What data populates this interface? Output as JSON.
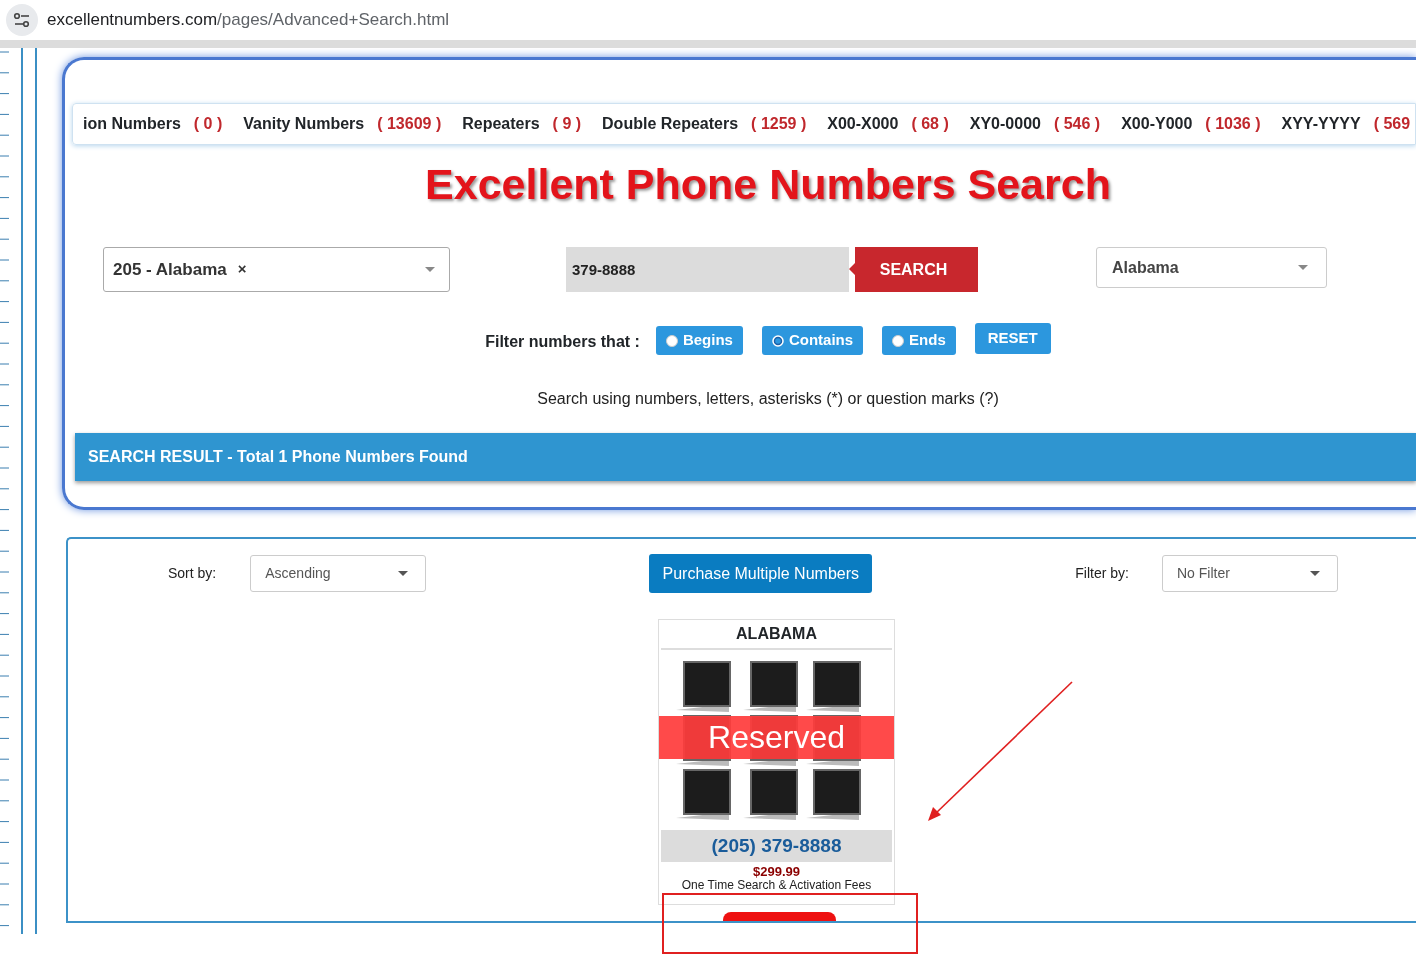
{
  "browser": {
    "url_host": "excellentnumbers.com",
    "url_path": "/pages/Advanced+Search.html"
  },
  "categories": [
    {
      "label": "ion Numbers",
      "count": "( 0 )"
    },
    {
      "label": "Vanity Numbers",
      "count": "( 13609 )"
    },
    {
      "label": "Repeaters",
      "count": "( 9 )"
    },
    {
      "label": "Double Repeaters",
      "count": "( 1259 )"
    },
    {
      "label": "X00-X000",
      "count": "( 68 )"
    },
    {
      "label": "XY0-0000",
      "count": "( 546 )"
    },
    {
      "label": "X00-Y000",
      "count": "( 1036 )"
    },
    {
      "label": "XYY-YYYY",
      "count": "( 569"
    }
  ],
  "title": "Excellent Phone Numbers Search",
  "area_code_select": {
    "value": "205 - Alabama",
    "clear": "×"
  },
  "search": {
    "value": "379-8888",
    "button": "SEARCH"
  },
  "state_select": {
    "value": "Alabama"
  },
  "filter": {
    "label": "Filter numbers that :",
    "options": [
      {
        "label": "Begins",
        "selected": false
      },
      {
        "label": "Contains",
        "selected": true
      },
      {
        "label": "Ends",
        "selected": false
      }
    ],
    "reset": "RESET"
  },
  "hint": "Search using numbers, letters, asterisks (*) or question marks (?)",
  "result_bar": {
    "title": "SEARCH RESULT - Total 1 Phone Numbers Found"
  },
  "sort": {
    "label": "Sort by:",
    "value": "Ascending"
  },
  "purchase_button": "Purchase Multiple Numbers",
  "filter_by": {
    "label": "Filter by:",
    "value": "No Filter"
  },
  "listings": [
    {
      "state": "ALABAMA",
      "reserved": true,
      "badge": "Reserved",
      "number": "(205) 379-8888",
      "price": "$299.99",
      "fee_note": "One Time Search & Activation Fees"
    }
  ],
  "annotations": [
    {
      "kind": "arrow"
    },
    {
      "kind": "rectangle"
    }
  ]
}
